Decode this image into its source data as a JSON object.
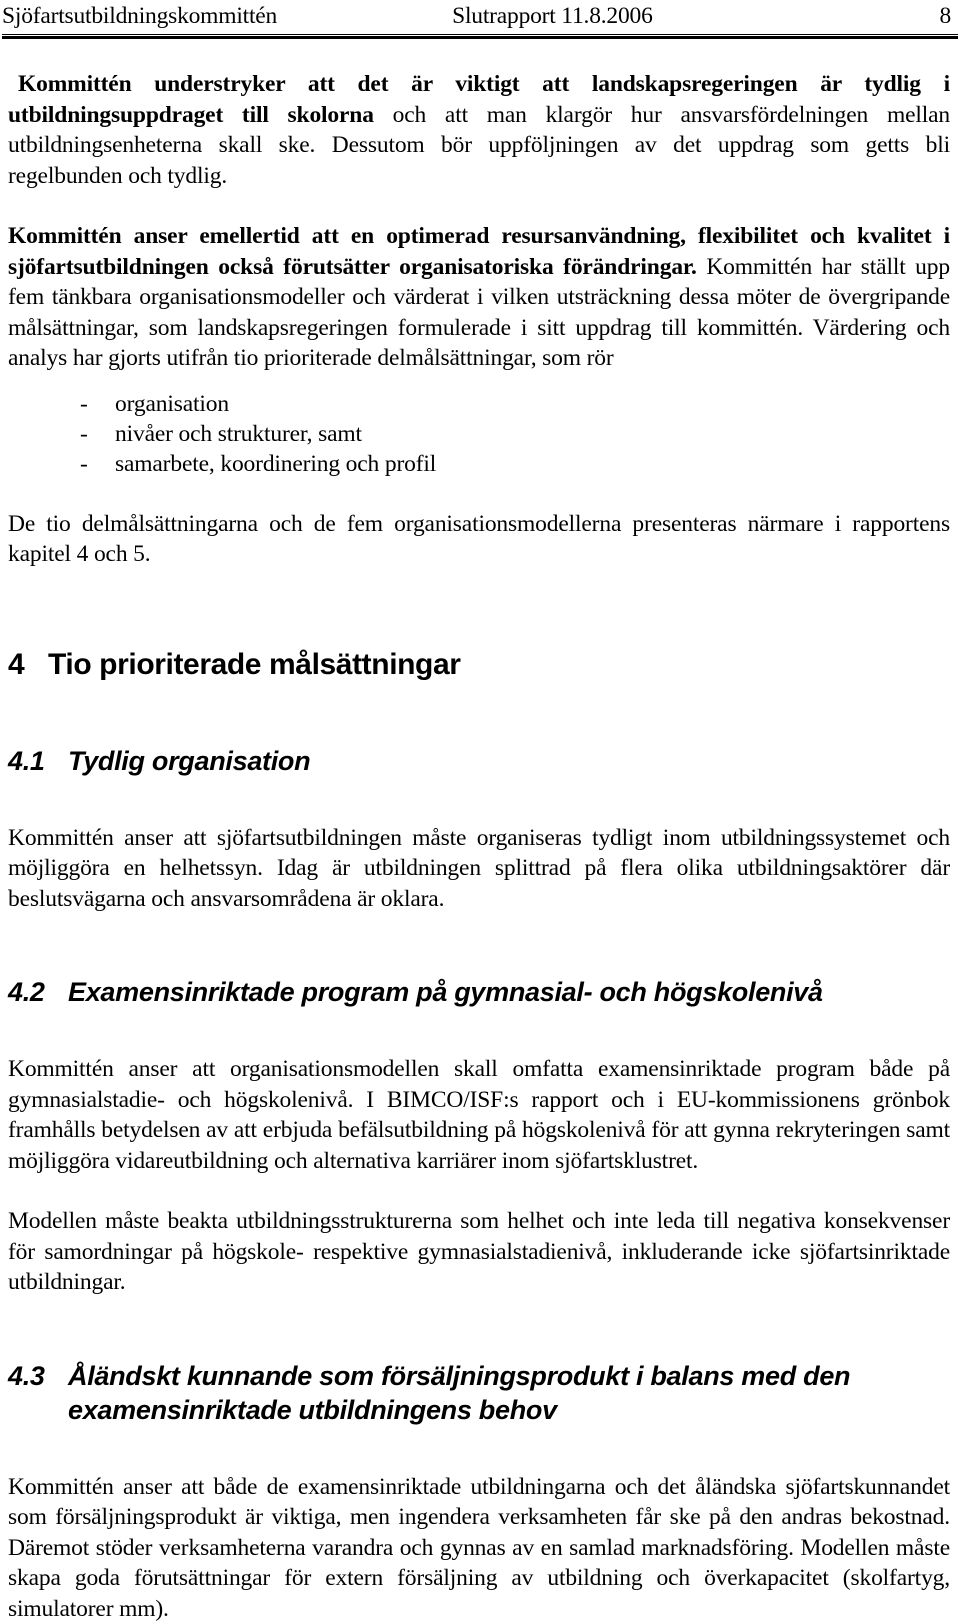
{
  "header": {
    "left": "Sjöfartsutbildningskommittén",
    "center": "Slutrapport 11.8.2006",
    "page_number": "8"
  },
  "body": {
    "para1_bold": "Kommittén understryker att det är viktigt att landskapsregeringen är tydlig i utbildningsuppdraget till skolorna",
    "para1_rest": " och att man klargör hur ansvarsfördelningen mellan utbildningsenheterna skall ske. Dessutom bör uppföljningen av det uppdrag som getts bli regelbunden och tydlig.",
    "para2_bold": "Kommittén anser emellertid att en optimerad resursanvändning, flexibilitet och kvalitet i sjöfartsutbildningen också förutsätter organisatoriska förändringar.",
    "para2_rest": " Kommittén har ställt upp fem tänkbara organisationsmodeller och värderat i vilken utsträckning dessa möter de övergripande målsättningar, som landskapsregeringen formulerade i sitt uppdrag till kommittén. Värdering och analys har gjorts utifrån tio prioriterade delmålsättningar, som rör",
    "list_marker": "-",
    "list_items": [
      "organisation",
      "nivåer och strukturer, samt",
      "samarbete, koordinering och profil"
    ],
    "para3": "De tio delmålsättningarna och de fem organisationsmodellerna presenteras närmare i rapportens kapitel 4 och 5."
  },
  "sections": {
    "h4": {
      "number": "4",
      "title": "Tio prioriterade målsättningar"
    },
    "h41": {
      "number": "4.1",
      "title": "Tydlig organisation",
      "para1": "Kommittén anser att sjöfartsutbildningen måste organiseras tydligt inom utbildningssystemet och möjliggöra en helhetssyn. Idag är utbildningen splittrad på flera olika utbildningsaktörer där beslutsvägarna och ansvarsområdena är oklara."
    },
    "h42": {
      "number": "4.2",
      "title": "Examensinriktade program på gymnasial- och högskolenivå",
      "para1": "Kommittén anser att organisationsmodellen skall omfatta examensinriktade program både på gymnasialstadie- och högskolenivå. I BIMCO/ISF:s  rapport och i EU-kommissionens grönbok framhålls betydelsen av att erbjuda befälsutbildning på högskolenivå för att gynna rekryteringen samt möjliggöra vidareutbildning och alternativa karriärer inom sjöfartsklustret.",
      "para2": "Modellen måste beakta utbildningsstrukturerna som helhet och inte leda till negativa konsekvenser för samordningar på högskole- respektive gymnasialstadienivå, inkluderande icke sjöfartsinriktade utbildningar."
    },
    "h43": {
      "number": "4.3",
      "title": "Åländskt kunnande som försäljningsprodukt i balans med den examensinriktade utbildningens behov",
      "para1": "Kommittén anser att både de examensinriktade utbildningarna och det åländska sjöfartskunnandet som försäljningsprodukt är viktiga, men ingendera verksamheten får ske på den andras bekostnad. Däremot stöder verksamheterna varandra och gynnas av en samlad marknadsföring. Modellen måste skapa goda förutsättningar för extern försäljning av utbildning och överkapacitet (skolfartyg, simulatorer mm)."
    }
  }
}
